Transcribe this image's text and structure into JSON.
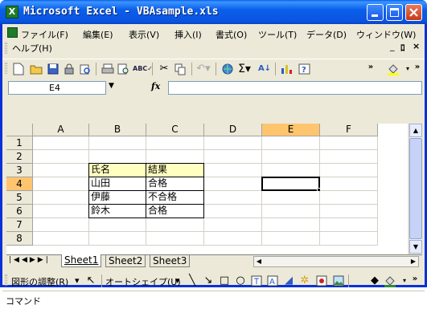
{
  "title": {
    "app_icon": "X",
    "text": "Microsoft Excel - VBAsample.xls"
  },
  "menu": {
    "items": [
      "ファイル(F)",
      "編集(E)",
      "表示(V)",
      "挿入(I)",
      "書式(O)",
      "ツール(T)",
      "データ(D)",
      "ウィンドウ(W)"
    ],
    "help": "ヘルプ(H)",
    "window_controls": [
      "_",
      "ﾛ",
      "×"
    ]
  },
  "toolbar_icons": [
    "new-icon",
    "open-icon",
    "save-icon",
    "permission-icon",
    "research-icon",
    "print-icon",
    "preview-icon",
    "spell-icon",
    "cut-icon",
    "copy-icon",
    "undo-icon",
    "hyperlink-icon",
    "autosum-icon",
    "sort-icon",
    "chart-icon",
    "help-icon",
    "fill-color-icon"
  ],
  "formula_bar": {
    "name_box": "E4",
    "fx": "fx",
    "value": ""
  },
  "columns": [
    "A",
    "B",
    "C",
    "D",
    "E",
    "F"
  ],
  "rows": [
    "1",
    "2",
    "3",
    "4",
    "5",
    "6",
    "7",
    "8"
  ],
  "selected": {
    "column": "E",
    "row": "4"
  },
  "cells": {
    "B3": "氏名",
    "C3": "結果",
    "B4": "山田",
    "C4": "合格",
    "B5": "伊藤",
    "C5": "不合格",
    "B6": "鈴木",
    "C6": "合格"
  },
  "sheets": [
    "Sheet1",
    "Sheet2",
    "Sheet3"
  ],
  "active_sheet": "Sheet1",
  "drawing": {
    "adjust": "図形の調整(R)",
    "autoshape": "オートシェイプ(U)"
  },
  "status": "コマンド",
  "colors": {
    "title_blue": "#0a5fea",
    "header_fill": "#ffffc0",
    "selection_header": "#ffc56e"
  }
}
